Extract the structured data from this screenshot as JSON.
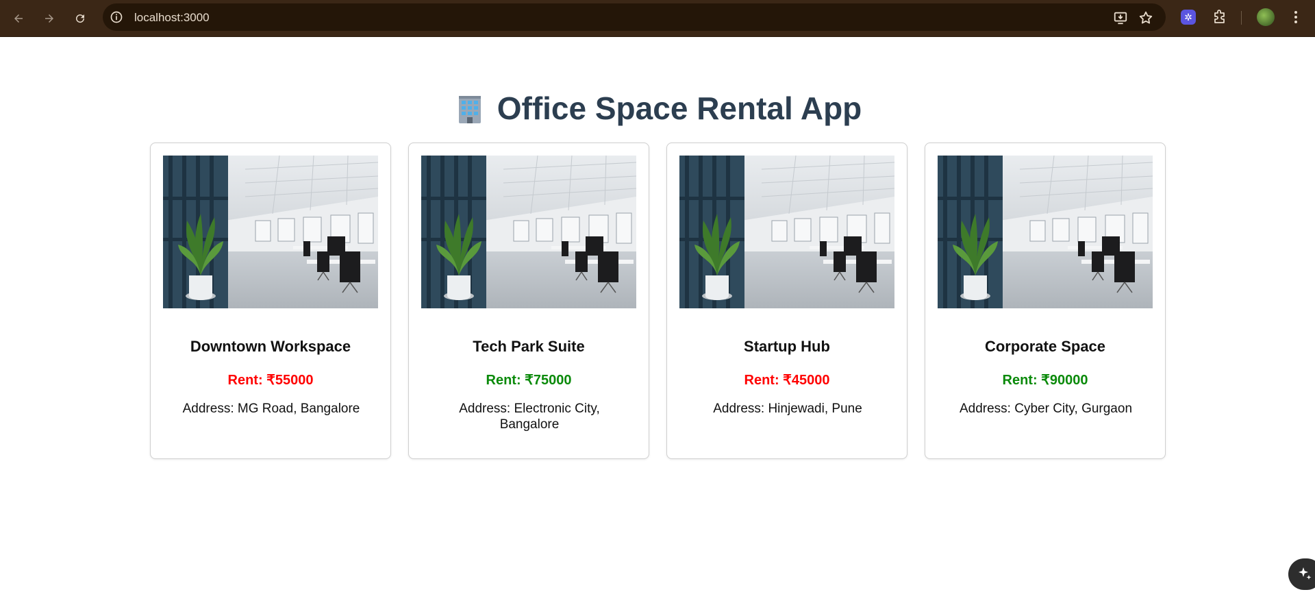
{
  "browser": {
    "url": "localhost:3000"
  },
  "page": {
    "title": "Office Space Rental App"
  },
  "offices": [
    {
      "name": "Downtown Workspace",
      "rent": "Rent: ₹55000",
      "rent_color": "#ff0000",
      "address": "Address: MG Road, Bangalore"
    },
    {
      "name": "Tech Park Suite",
      "rent": "Rent: ₹75000",
      "rent_color": "#0a8a0a",
      "address": "Address: Electronic City, Bangalore"
    },
    {
      "name": "Startup Hub",
      "rent": "Rent: ₹45000",
      "rent_color": "#ff0000",
      "address": "Address: Hinjewadi, Pune"
    },
    {
      "name": "Corporate Space",
      "rent": "Rent: ₹90000",
      "rent_color": "#0a8a0a",
      "address": "Address: Cyber City, Gurgaon"
    }
  ],
  "icons": {
    "back": "arrow-left-icon",
    "forward": "arrow-right-icon",
    "reload": "reload-icon",
    "site_info": "info-icon",
    "install": "install-app-icon",
    "bookmark": "star-icon",
    "extension": "puzzle-icon",
    "title": "office-building-icon",
    "menu": "more-vertical-icon"
  }
}
